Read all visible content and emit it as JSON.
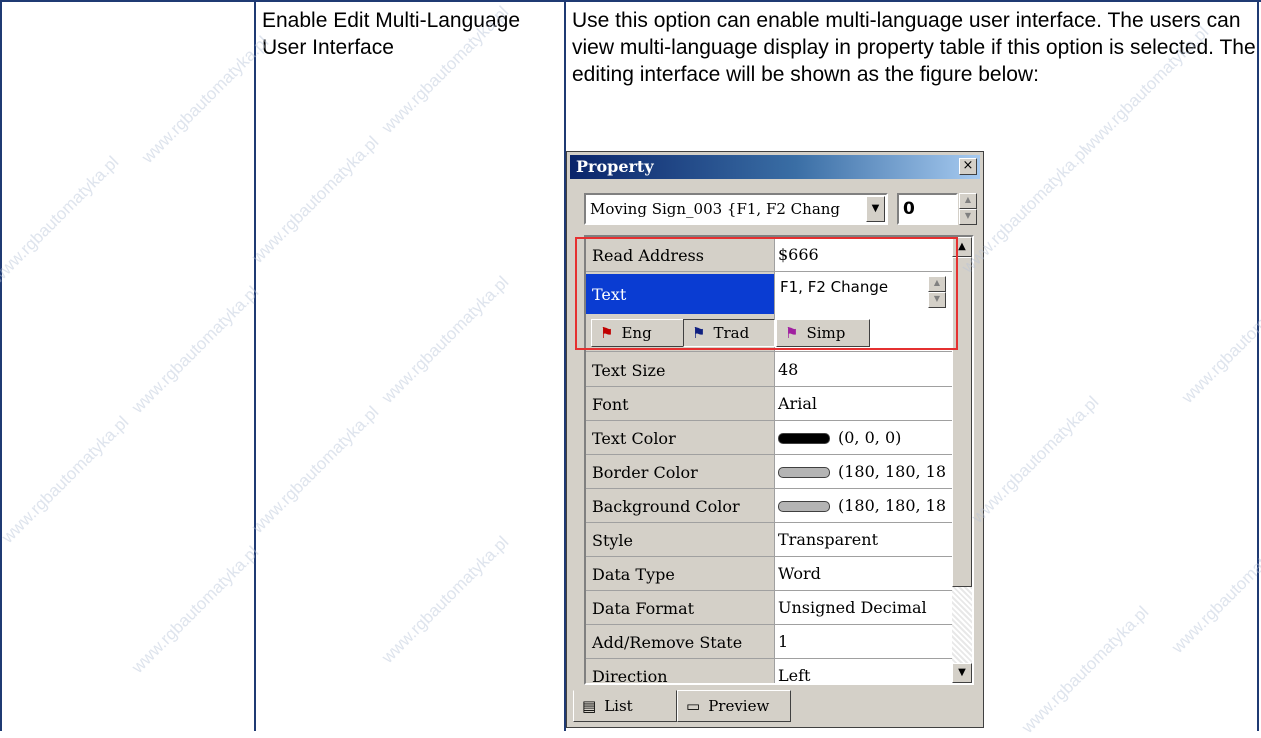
{
  "row": {
    "feature": "Enable Edit Multi-Language User Interface",
    "description": "Use this option can enable multi-language user interface. The users can view multi-language display in property table if this option is selected. The editing interface will be shown as the figure below:"
  },
  "property_window": {
    "title": "Property",
    "close_glyph": "×",
    "object_select": "Moving Sign_003 {F1, F2 Chang",
    "object_index": "0",
    "text_row": {
      "label": "Text",
      "value": "F1, F2 Change"
    },
    "languages": [
      {
        "label": "Eng",
        "color": "#c00000"
      },
      {
        "label": "Trad",
        "color": "#102080"
      },
      {
        "label": "Simp",
        "color": "#a020a0"
      }
    ],
    "properties": [
      {
        "label": "Read Address",
        "value": "$666"
      },
      {
        "label": "Text Size",
        "value": "48"
      },
      {
        "label": "Font",
        "value": "Arial"
      },
      {
        "label": "Text Color",
        "value": "(0, 0, 0)",
        "swatch": "#000000"
      },
      {
        "label": "Border Color",
        "value": "(180, 180, 18",
        "swatch": "#b4b4b4"
      },
      {
        "label": "Background Color",
        "value": "(180, 180, 18",
        "swatch": "#b4b4b4"
      },
      {
        "label": "Style",
        "value": "Transparent"
      },
      {
        "label": "Data Type",
        "value": "Word"
      },
      {
        "label": "Data Format",
        "value": "Unsigned Decimal"
      },
      {
        "label": "Add/Remove State",
        "value": "1"
      },
      {
        "label": "Direction",
        "value": "Left"
      }
    ],
    "tabs": [
      {
        "label": "List"
      },
      {
        "label": "Preview"
      }
    ]
  },
  "watermark": "www.rgbautomatyka.pl",
  "colors": {
    "grid_line": "#1f3a73",
    "selected_row": "#0a3cd2",
    "highlight": "#e53030",
    "titlebar": "#0a246a"
  }
}
